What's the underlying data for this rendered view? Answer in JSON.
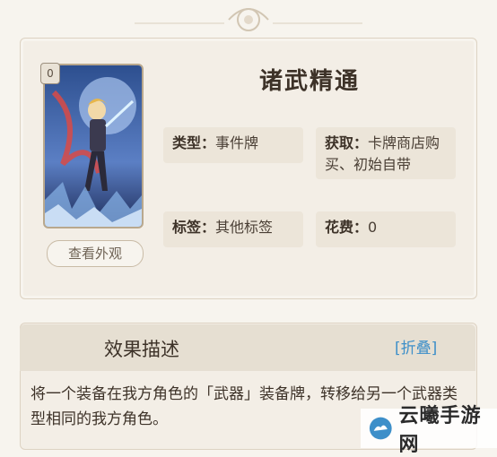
{
  "card": {
    "cost": "0",
    "title": "诸武精通",
    "view_button": "查看外观",
    "type_label": "类型：",
    "type_value": "事件牌",
    "obtain_label": "获取：",
    "obtain_value": "卡牌商店购买、初始自带",
    "tag_label": "标签：",
    "tag_value": "其他标签",
    "cost_label": "花费：",
    "cost_value": "0"
  },
  "effect": {
    "title": "效果描述",
    "fold_button": "[折叠]",
    "text": "将一个装备在我方角色的「武器」装备牌，转移给另一个武器类型相同的我方角色。"
  },
  "watermark": {
    "text": "云曦手游网"
  },
  "colors": {
    "background": "#f7f4ee",
    "panel": "#f3eee6",
    "field": "#ece5d9",
    "accent_link": "#3d8fc9",
    "text_dark": "#3d3228"
  }
}
